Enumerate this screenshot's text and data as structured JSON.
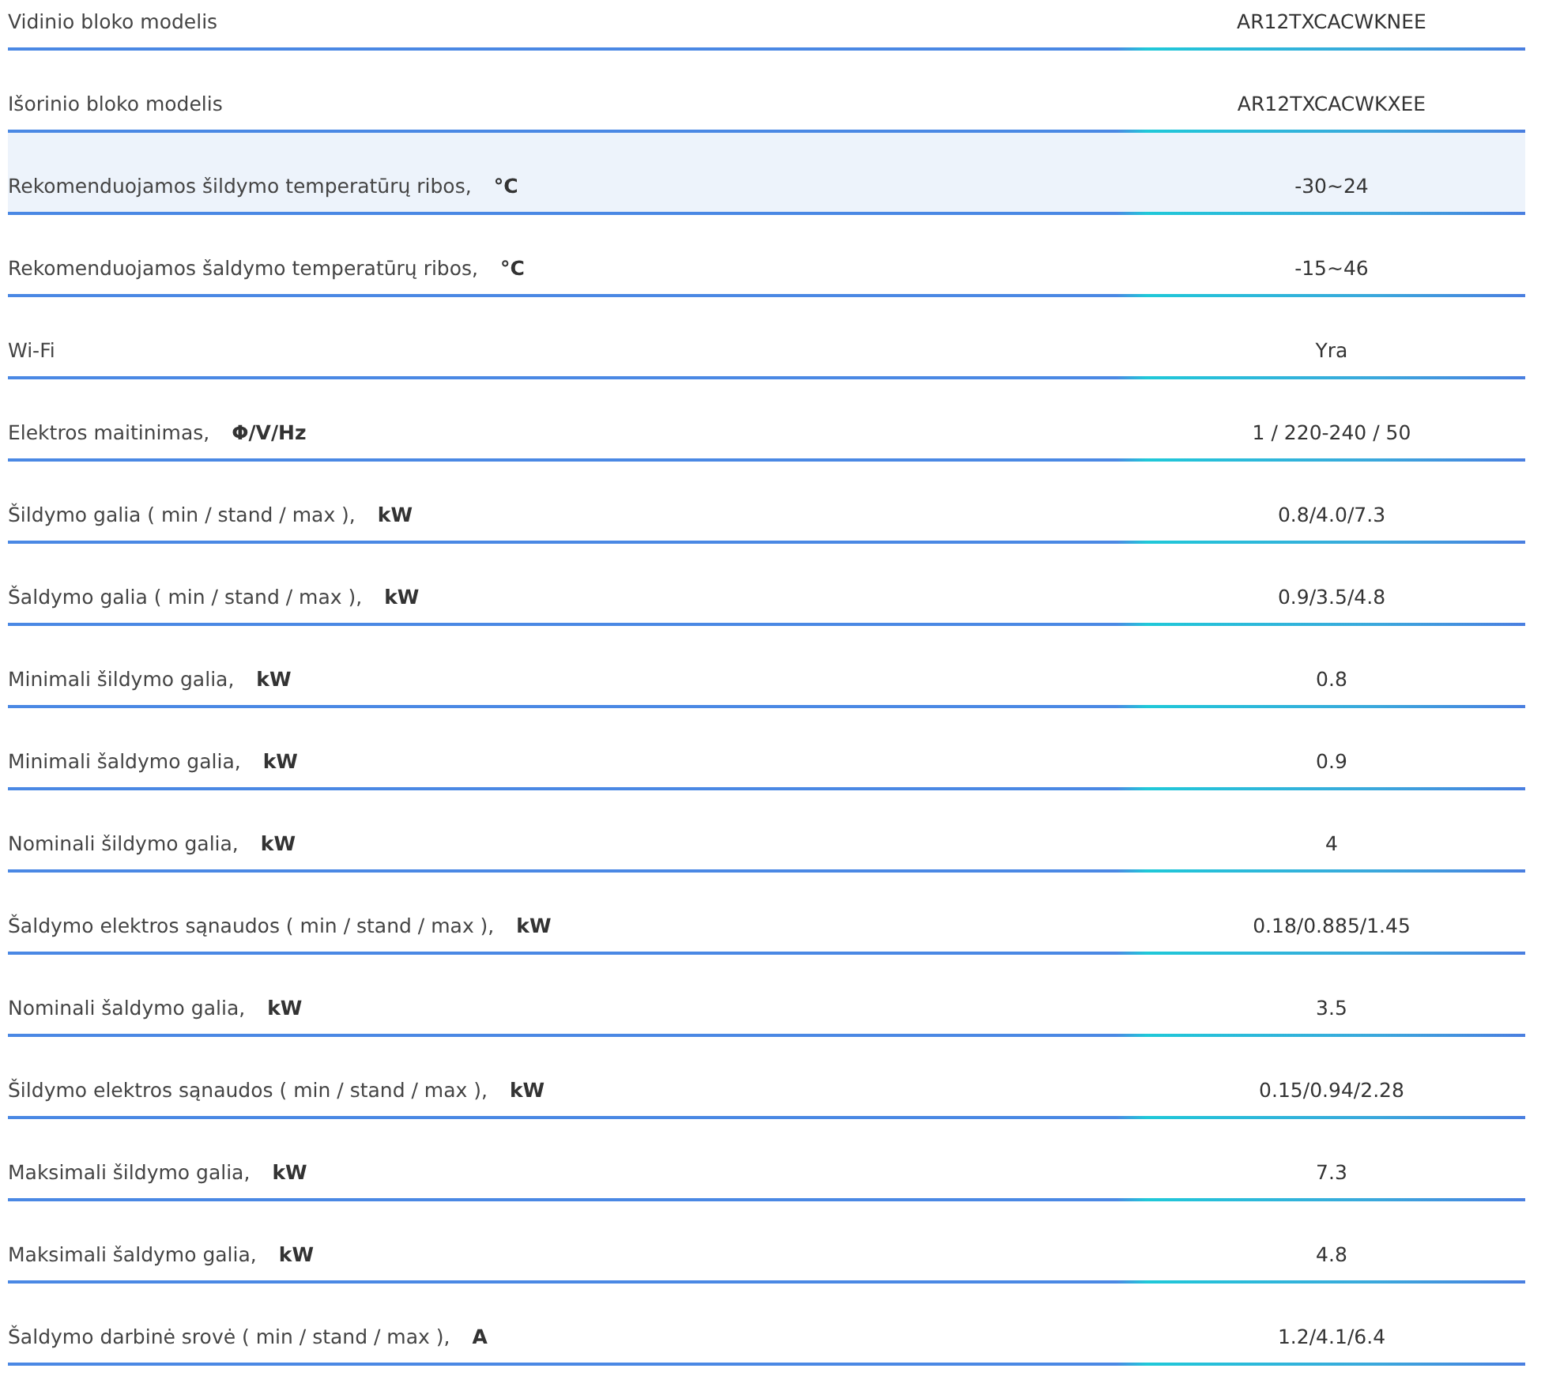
{
  "specs": [
    {
      "label": "Vidinio bloko modelis",
      "value": "AR12TXCACWKNEE",
      "highlighted": false
    },
    {
      "label": "Išorinio bloko modelis",
      "value": "AR12TXCACWKXEE",
      "highlighted": false
    },
    {
      "label": "Rekomenduojamos šildymo temperatūrų ribos,",
      "unit": "°C",
      "value": "-30~24",
      "highlighted": true
    },
    {
      "label": "Rekomenduojamos šaldymo temperatūrų ribos,",
      "unit": "°C",
      "value": "-15~46",
      "highlighted": false
    },
    {
      "label": "Wi-Fi",
      "value": "Yra",
      "highlighted": false
    },
    {
      "label": "Elektros maitinimas,",
      "unit": "Φ/V/Hz",
      "value": "1 / 220-240 / 50",
      "highlighted": false
    },
    {
      "label": "Šildymo galia ( min / stand / max ),",
      "unit": "kW",
      "value": "0.8/4.0/7.3",
      "highlighted": false
    },
    {
      "label": "Šaldymo galia ( min / stand / max ),",
      "unit": "kW",
      "value": "0.9/3.5/4.8",
      "highlighted": false
    },
    {
      "label": "Minimali šildymo galia,",
      "unit": "kW",
      "value": "0.8",
      "highlighted": false
    },
    {
      "label": "Minimali šaldymo galia,",
      "unit": "kW",
      "value": "0.9",
      "highlighted": false
    },
    {
      "label": "Nominali šildymo galia,",
      "unit": "kW",
      "value": "4",
      "highlighted": false
    },
    {
      "label": "Šaldymo elektros sąnaudos ( min / stand / max ),",
      "unit": "kW",
      "value": "0.18/0.885/1.45",
      "highlighted": false
    },
    {
      "label": "Nominali šaldymo galia,",
      "unit": "kW",
      "value": "3.5",
      "highlighted": false
    },
    {
      "label": "Šildymo elektros sąnaudos ( min / stand / max ),",
      "unit": "kW",
      "value": "0.15/0.94/2.28",
      "highlighted": false
    },
    {
      "label": "Maksimali šildymo galia,",
      "unit": "kW",
      "value": "7.3",
      "highlighted": false
    },
    {
      "label": "Maksimali šaldymo galia,",
      "unit": "kW",
      "value": "4.8",
      "highlighted": false
    },
    {
      "label": "Šaldymo darbinė srovė ( min / stand / max ),",
      "unit": "A",
      "value": "1.2/4.1/6.4",
      "highlighted": false
    }
  ]
}
